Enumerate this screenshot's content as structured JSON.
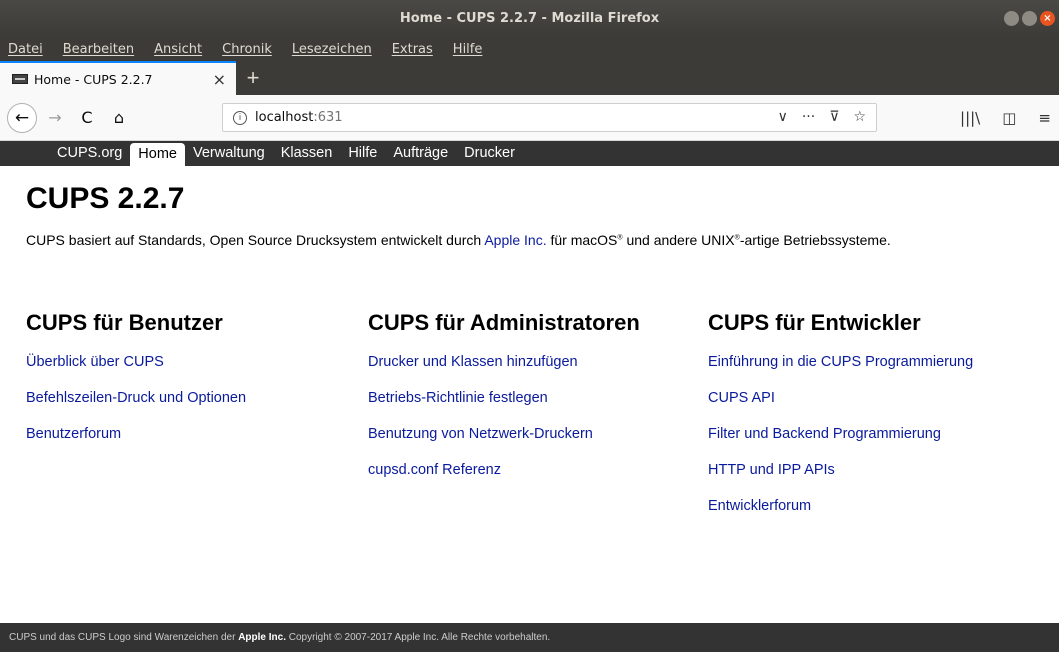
{
  "window": {
    "title": "Home - CUPS 2.2.7 - Mozilla Firefox"
  },
  "menu": [
    "Datei",
    "Bearbeiten",
    "Ansicht",
    "Chronik",
    "Lesezeichen",
    "Extras",
    "Hilfe"
  ],
  "tab": {
    "title": "Home - CUPS 2.2.7",
    "close": "×",
    "new": "+"
  },
  "url": {
    "host": "localhost",
    "port": ":631"
  },
  "icons": {
    "back": "←",
    "forward": "→",
    "reload": "C",
    "home": "⌂",
    "info": "i",
    "dropdown": "∨",
    "more": "···",
    "pocket": "⊽",
    "bookmark": "☆",
    "library": "|||\\",
    "sidebar": "◫",
    "menu": "≡"
  },
  "cupsnav": [
    "CUPS.org",
    "Home",
    "Verwaltung",
    "Klassen",
    "Hilfe",
    "Aufträge",
    "Drucker"
  ],
  "page": {
    "title": "CUPS 2.2.7",
    "intro_a": "CUPS basiert auf Standards, Open Source Drucksystem entwickelt durch ",
    "intro_link": "Apple Inc.",
    "intro_b": " für macOS",
    "intro_reg1": "®",
    "intro_c": " und andere UNIX",
    "intro_reg2": "®",
    "intro_d": "-artige Betriebssysteme."
  },
  "columns": [
    {
      "heading": "CUPS für Benutzer",
      "links": [
        "Überblick über CUPS",
        "Befehlszeilen-Druck und Optionen",
        "Benutzerforum"
      ]
    },
    {
      "heading": "CUPS für Administratoren",
      "links": [
        "Drucker und Klassen hinzufügen",
        "Betriebs-Richtlinie festlegen",
        "Benutzung von Netzwerk-Druckern",
        "cupsd.conf Referenz"
      ]
    },
    {
      "heading": "CUPS für Entwickler",
      "links": [
        "Einführung in die CUPS Programmierung",
        "CUPS API",
        "Filter und Backend Programmierung",
        "HTTP und IPP APIs",
        "Entwicklerforum"
      ]
    }
  ],
  "footer": {
    "a": "CUPS und das CUPS Logo sind Warenzeichen der ",
    "link": "Apple Inc.",
    "b": " Copyright © 2007-2017 Apple Inc. Alle Rechte vorbehalten."
  }
}
